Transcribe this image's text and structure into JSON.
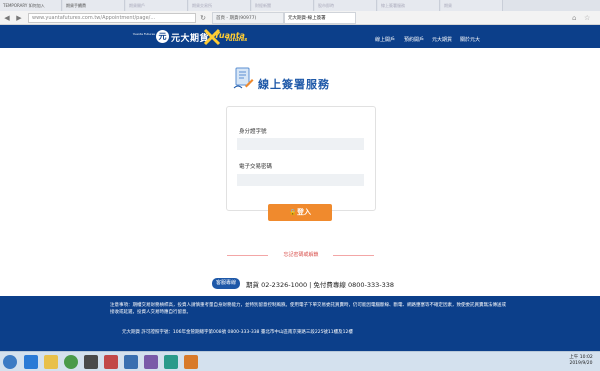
{
  "browser": {
    "tabs": [
      "TEMPORARY 如何加入",
      "期貨手續費",
      "期貨開戶",
      "期貨交易所",
      "財經新聞",
      "股市即時",
      "線上簽署服務",
      "期貨",
      "元大期貨",
      "客服",
      "登入"
    ],
    "url_domain": "www.yuantafutures.com.tw",
    "url_path": "/Appointment/page/...",
    "page_tabs": [
      {
        "label": "首頁 - 期貨(90977)"
      },
      {
        "label": "元大期貨-線上簽署"
      }
    ]
  },
  "header": {
    "logo_en": "Yuanta Futures",
    "logo_cn": "元大期貨",
    "logo_sub": "Yuanta",
    "logo_sub2": "Futures",
    "nav": [
      "線上開戶",
      "預約開戶",
      "元大期貨",
      "關於元大"
    ]
  },
  "main": {
    "title": "線上簽署服務",
    "id_label": "身分證字號",
    "id_value": "",
    "pwd_label": "電子交易密碼",
    "pwd_value": "",
    "login_label": "登入",
    "forgot_label": "忘記密碼或解鎖"
  },
  "service": {
    "badge": "客服專線",
    "text": "期貨 02-2326-1000 | 免付費專線 0800-333-338"
  },
  "footer": {
    "notice": "注意事項：期權交易財務槓桿高，投資人請慎重考量自身財務能力，並特別留意控制風險。使用電子下單交易委託買賣時，仍可能因電腦斷線、斷電、網路壅塞等不確定因素，致使委託買賣無法傳送或接收或延遲，投資人交易時應自行留意。",
    "license": "元大期貨 許可證照字號：106年金管期總字第008號 0800-333-338 臺北市中山區南京東路三段225號11樓及12樓"
  },
  "taskbar": {
    "time": "上午 10:02",
    "date": "2019/9/20"
  },
  "colors": {
    "brand_blue": "#0c3f8a",
    "accent_orange": "#f08a2d",
    "title_blue": "#1e58a8"
  }
}
